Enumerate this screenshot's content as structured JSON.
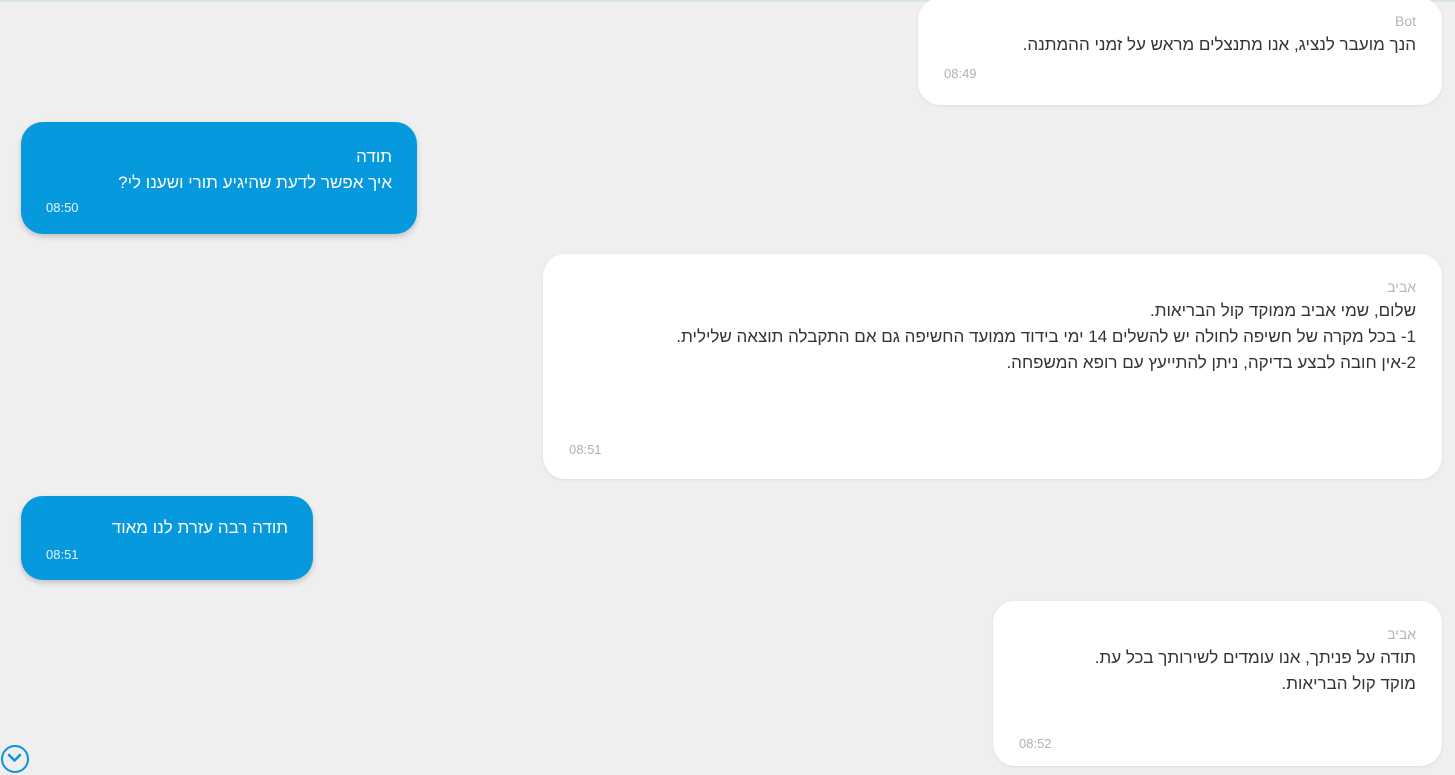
{
  "messages": [
    {
      "sender": "Bot",
      "lines": [
        "הנך מועבר לנציג, אנו מתנצלים מראש על זמני ההמתנה."
      ],
      "time": "08:49"
    },
    {
      "lines": [
        "תודה",
        "איך אפשר לדעת שהיגיע תורי ושענו לי?"
      ],
      "time": "08:50"
    },
    {
      "sender": "אביב",
      "lines": [
        "שלום, שמי אביב ממוקד קול הבריאות.",
        "1- בכל מקרה של חשיפה לחולה יש להשלים 14 ימי בידוד ממועד החשיפה גם אם התקבלה תוצאה שלילית.",
        "2-אין חובה לבצע בדיקה, ניתן להתייעץ עם רופא המשפחה."
      ],
      "time": "08:51"
    },
    {
      "lines": [
        "תודה רבה עזרת לנו מאוד"
      ],
      "time": "08:51"
    },
    {
      "sender": "אביב",
      "lines": [
        "תודה על פניתך, אנו עומדים לשירותך בכל עת.",
        "מוקד קול הבריאות."
      ],
      "time": "08:52"
    }
  ],
  "scroll_button": {
    "icon": "chevron-down-icon"
  },
  "colors": {
    "background": "#efefef",
    "agent_bubble": "#ffffff",
    "user_bubble": "#0799de",
    "accent": "#0a93d8"
  }
}
